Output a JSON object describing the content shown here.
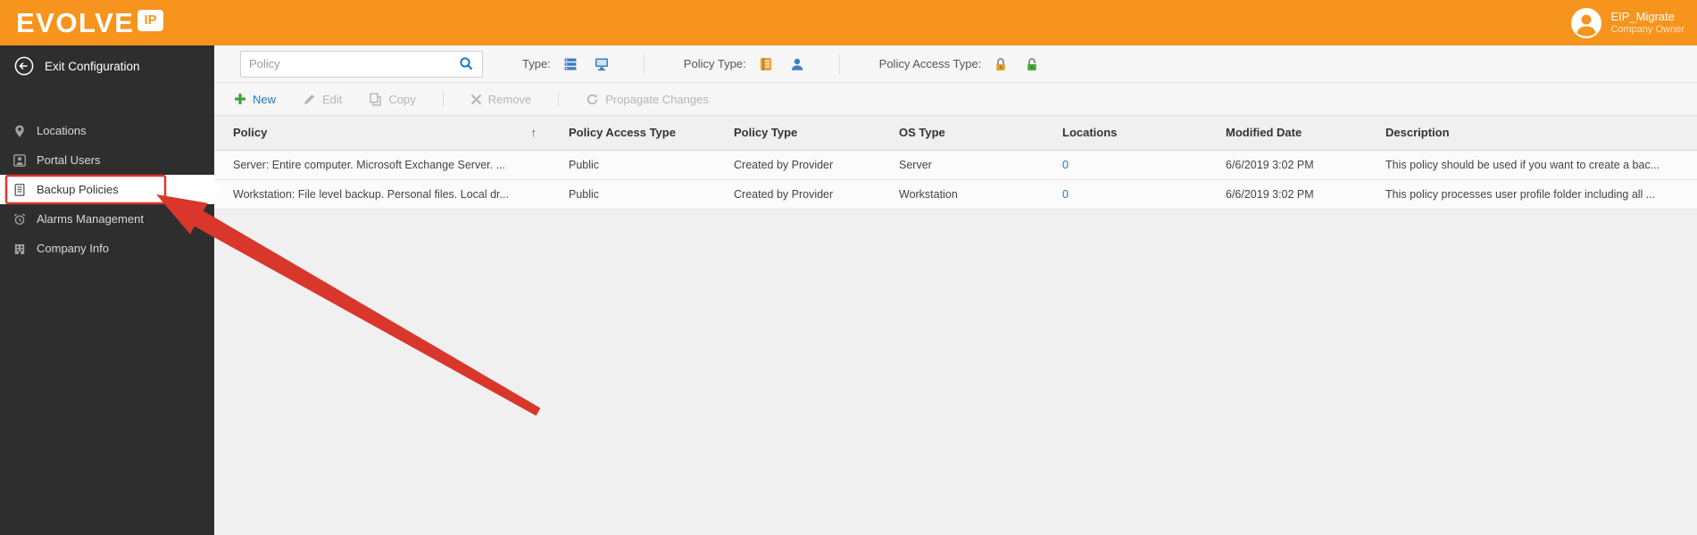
{
  "header": {
    "logo": {
      "brand": "EVOLVE",
      "bubble": "IP"
    },
    "user": {
      "name": "EIP_Migrate",
      "role": "Company Owner"
    }
  },
  "sidebar": {
    "exit_label": "Exit Configuration",
    "items": [
      {
        "label": "Locations",
        "icon": "location-pin-icon",
        "selected": false
      },
      {
        "label": "Portal Users",
        "icon": "portal-user-icon",
        "selected": false
      },
      {
        "label": "Backup Policies",
        "icon": "backup-policy-icon",
        "selected": true
      },
      {
        "label": "Alarms Management",
        "icon": "alarm-icon",
        "selected": false
      },
      {
        "label": "Company Info",
        "icon": "company-building-icon",
        "selected": false
      }
    ]
  },
  "filters": {
    "search_placeholder": "Policy",
    "type_label": "Type:",
    "policy_type_label": "Policy Type:",
    "access_type_label": "Policy Access Type:",
    "icons": {
      "search": "magnifier-icon",
      "type": [
        "server-type-icon",
        "workstation-type-icon"
      ],
      "policy_type": [
        "provider-policy-icon",
        "user-policy-icon"
      ],
      "access_type": [
        "private-lock-icon",
        "public-lock-icon"
      ]
    }
  },
  "toolbar": {
    "new_label": "New",
    "edit_label": "Edit",
    "copy_label": "Copy",
    "remove_label": "Remove",
    "propagate_label": "Propagate Changes"
  },
  "table": {
    "sort_indicator": "↑",
    "columns": [
      "Policy",
      "Policy Access Type",
      "Policy Type",
      "OS Type",
      "Locations",
      "Modified Date",
      "Description"
    ],
    "rows": [
      {
        "policy": "Server: Entire computer. Microsoft Exchange Server. ...",
        "access": "Public",
        "type": "Created by Provider",
        "os": "Server",
        "locations": "0",
        "modified": "6/6/2019 3:02 PM",
        "description": "This policy should be used if you want to create a bac..."
      },
      {
        "policy": "Workstation: File level backup. Personal files. Local dr...",
        "access": "Public",
        "type": "Created by Provider",
        "os": "Workstation",
        "locations": "0",
        "modified": "6/6/2019 3:02 PM",
        "description": "This policy processes user profile folder including all ..."
      }
    ]
  },
  "colors": {
    "brand_orange": "#F7941D",
    "link_blue": "#1E7BC4",
    "annotation_red": "#D9372C",
    "new_green": "#3FA535",
    "sidebar_dark": "#2E2E2E"
  }
}
